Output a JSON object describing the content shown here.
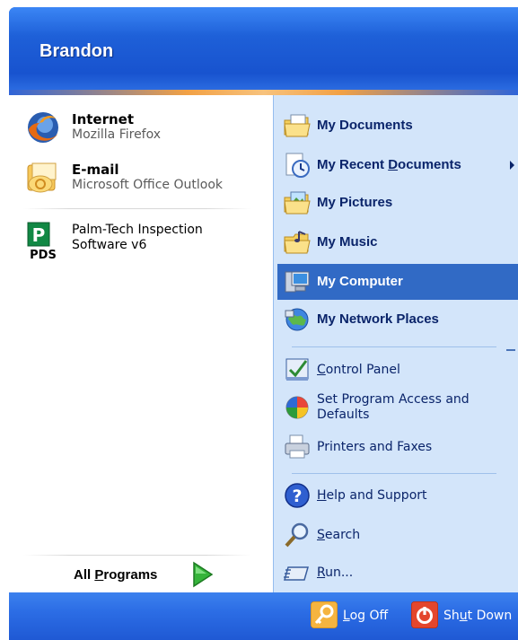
{
  "user": {
    "name": "Brandon"
  },
  "pinned": [
    {
      "title": "Internet",
      "subtitle": "Mozilla Firefox",
      "icon": "firefox-icon"
    },
    {
      "title": "E-mail",
      "subtitle": "Microsoft Office Outlook",
      "icon": "outlook-icon"
    }
  ],
  "recent": [
    {
      "line1": "Palm-Tech Inspection",
      "line2": "Software v6",
      "icon": "palmtech-icon",
      "icon_text": "PDS"
    }
  ],
  "all_programs": {
    "label_pre": "All ",
    "label_ul": "P",
    "label_post": "rograms"
  },
  "places": [
    {
      "label": "My Documents",
      "icon": "my-documents-icon"
    },
    {
      "label_pre": "My Recent ",
      "label_ul": "D",
      "label_post": "ocuments",
      "icon": "recent-documents-icon"
    },
    {
      "label": "My Pictures",
      "icon": "my-pictures-icon"
    },
    {
      "label": "My Music",
      "icon": "my-music-icon"
    },
    {
      "label": "My Computer",
      "icon": "my-computer-icon",
      "selected": true
    },
    {
      "label": "My Network Places",
      "icon": "network-places-icon"
    }
  ],
  "settings": [
    {
      "label_ul": "C",
      "label_post": "ontrol Panel",
      "icon": "control-panel-icon"
    },
    {
      "line1": "Set Program Access and",
      "line2": "Defaults",
      "icon": "program-access-icon"
    },
    {
      "label": "Printers and Faxes",
      "icon": "printer-icon"
    }
  ],
  "help": [
    {
      "label_ul": "H",
      "label_post": "elp and Support",
      "icon": "help-icon"
    },
    {
      "label_ul": "S",
      "label_post": "earch",
      "icon": "search-icon"
    },
    {
      "label_ul": "R",
      "label_post": "un...",
      "icon": "run-icon"
    }
  ],
  "footer": {
    "logoff": {
      "label_pre": "",
      "label_ul": "L",
      "label_post": "og Off",
      "icon": "key-icon"
    },
    "shutdown": {
      "label_pre": "Sh",
      "label_ul": "u",
      "label_post": "t Down",
      "icon": "power-icon"
    }
  },
  "colors": {
    "header_blue": "#1e60d8",
    "places_bg": "#d3e5fa",
    "selected": "#316ac5",
    "text_blue": "#0a246a"
  }
}
